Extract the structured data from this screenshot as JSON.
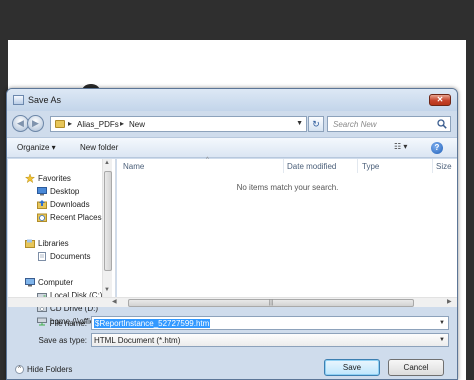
{
  "dialog": {
    "title": "Save As",
    "close_label": "✕"
  },
  "address": {
    "crumbs": [
      "Alias_PDFs",
      "New"
    ],
    "separator": "▸"
  },
  "search": {
    "placeholder": "Search New"
  },
  "toolbar": {
    "organize_label": "Organize ▾",
    "new_folder_label": "New folder",
    "views_label": "☷ ▾",
    "help_label": "?"
  },
  "navpane": {
    "favorites_header": "Favorites",
    "favorites": [
      "Desktop",
      "Downloads",
      "Recent Places"
    ],
    "libraries_header": "Libraries",
    "libraries": [
      "Documents"
    ],
    "computer_header": "Computer",
    "computer": [
      "Local Disk (C:)",
      "CD Drive (D:)",
      "home (\\\\office60"
    ]
  },
  "filelist": {
    "columns": [
      "Name",
      "Date modified",
      "Type",
      "Size"
    ],
    "empty_message": "No items match your search."
  },
  "form": {
    "filename_label": "File name:",
    "filename_value": "$ReportInstance_52727599.htm",
    "savetype_label": "Save as type:",
    "savetype_value": "HTML Document (*.htm)"
  },
  "footer": {
    "hide_folders_label": "Hide Folders",
    "save_label": "Save",
    "cancel_label": "Cancel"
  },
  "colors": {
    "dialog_bg": "#cfdcec",
    "accent": "#3399ff",
    "close": "#c6432b"
  }
}
